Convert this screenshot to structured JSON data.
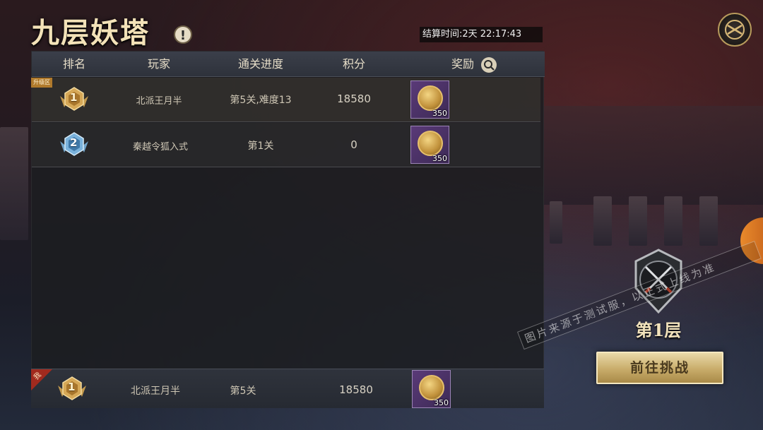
{
  "header": {
    "title": "九层妖塔",
    "info_icon": "exclamation-icon",
    "countdown": "结算时间:2天  22:17:43",
    "top_right_icon": "exchange-icon"
  },
  "table": {
    "columns": [
      "排名",
      "玩家",
      "通关进度",
      "积分",
      "奖励"
    ],
    "reward_search_icon": "magnifier-icon",
    "rows": [
      {
        "tag": "升级区",
        "rank": "1",
        "player": "北派王月半",
        "progress": "第5关,难度13",
        "score": "18580",
        "reward_count": "350",
        "reward_icon": "dragon-coin-icon"
      },
      {
        "rank": "2",
        "player": "秦越令狐入式",
        "progress": "第1关",
        "score": "0",
        "reward_count": "350",
        "reward_icon": "dragon-coin-icon"
      }
    ]
  },
  "self_row": {
    "tag": "我",
    "rank": "1",
    "player": "北派王月半",
    "progress": "第5关",
    "score": "18580",
    "reward_count": "350"
  },
  "side": {
    "emblem_icon": "crossed-swords-emblem-icon",
    "layer_label": "第1层",
    "challenge_button": "前往挑战"
  },
  "watermark": "图片来源于测试服，以正式上线为准",
  "colors": {
    "title_gold": "#f3e2b8",
    "reward_purple": "#5a3a78",
    "button_gold": "#c8ac6a",
    "self_tag_red": "#a12a1e"
  }
}
